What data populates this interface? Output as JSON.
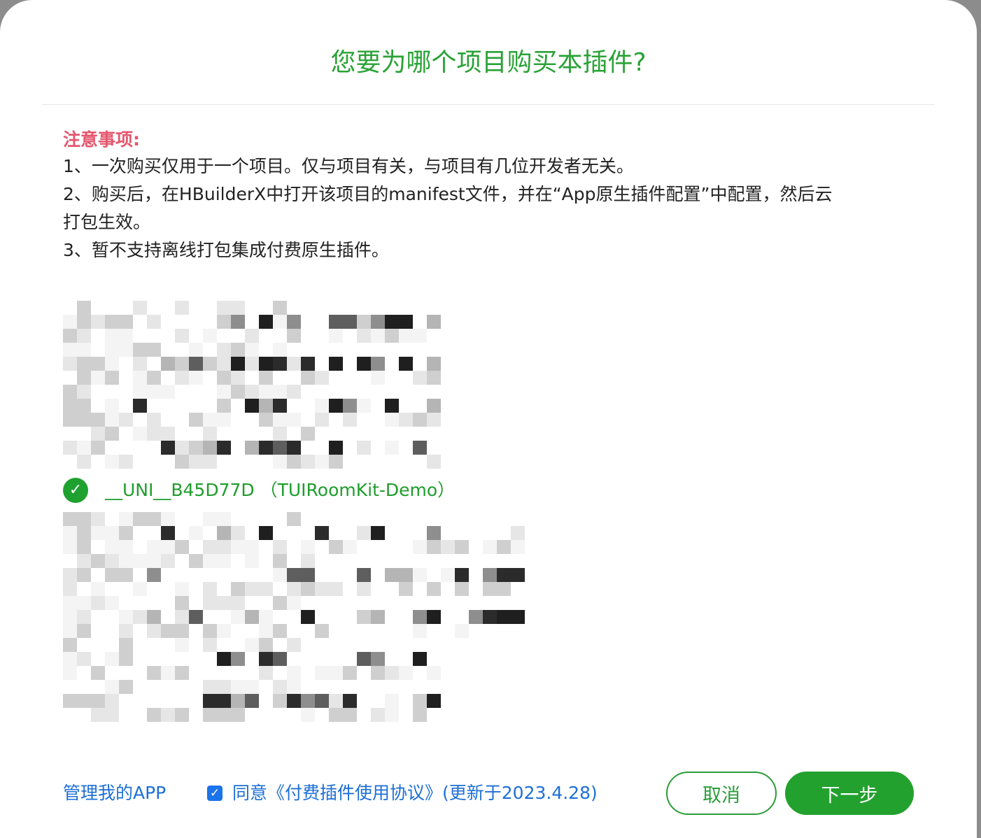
{
  "dialog": {
    "title": "您要为哪个项目购买本插件?"
  },
  "notice": {
    "heading": "注意事项:",
    "lines": [
      "1、一次购买仅用于一个项目。仅与项目有关，与项目有几位开发者无关。",
      "2、购买后，在HBuilderX中打开该项目的manifest文件，并在“App原生插件配置”中配置，然后云",
      "打包生效。",
      "3、暂不支持离线打包集成付费原生插件。"
    ]
  },
  "projects": {
    "selected": "__UNI__B45D77D （TUIRoomKit-Demo）",
    "check_icon": "check-icon"
  },
  "footer": {
    "manage_label": "管理我的APP",
    "agree_label": "同意《付费插件使用协议》(更新于2023.4.28)",
    "agree_checked": true,
    "cancel_label": "取消",
    "next_label": "下一步"
  },
  "colors": {
    "accent_green": "#22a12e",
    "link_blue": "#1d6fd6",
    "notice_red": "#e4566e"
  }
}
